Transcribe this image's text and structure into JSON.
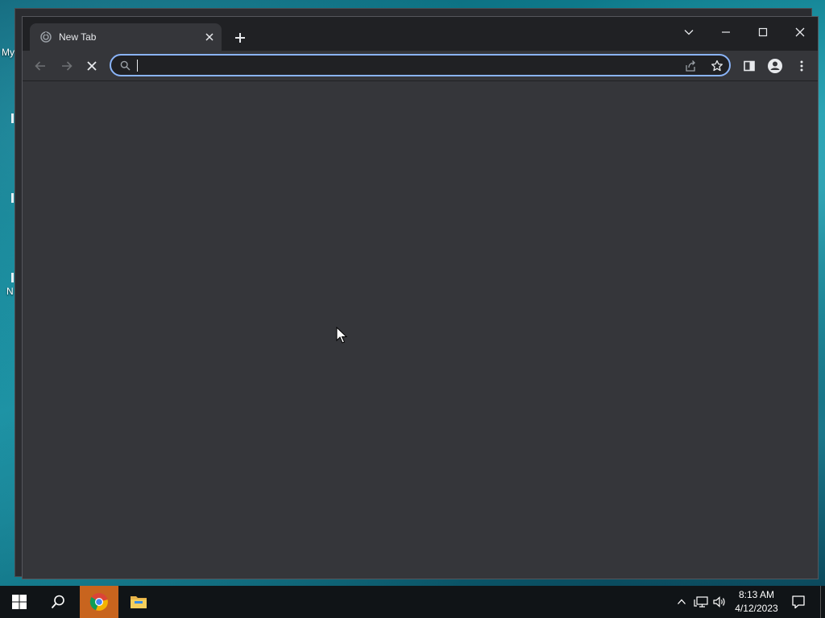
{
  "desktop": {
    "icon_labels": [
      "My",
      "N"
    ]
  },
  "browser": {
    "tab": {
      "title": "New Tab"
    },
    "omnibox": {
      "value": "",
      "placeholder": ""
    },
    "state": "loading"
  },
  "taskbar": {
    "clock_time": "8:13 AM",
    "clock_date": "4/12/2023",
    "pinned": [
      "start-icon",
      "search-icon",
      "chrome-icon",
      "file-explorer-icon"
    ],
    "active_app": "chrome"
  },
  "colors": {
    "omnibox_focus": "#8ab4f8",
    "titlebar": "#202124",
    "content": "#35363a",
    "taskbar_active": "#c8641e"
  }
}
